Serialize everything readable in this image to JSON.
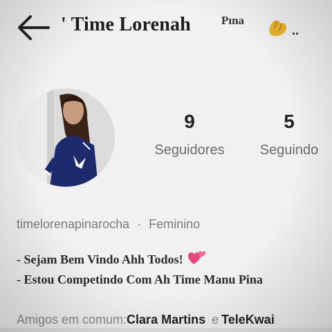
{
  "header": {
    "title": "' Time Lorenah",
    "title_suffix": "Pına",
    "trailing": ".."
  },
  "profile": {
    "followers_count": "9",
    "followers_label": "Seguidores",
    "following_count": "5",
    "following_label": "Seguindo",
    "username": "timelorenapinarocha",
    "separator": "·",
    "gender": "Feminino",
    "bio_line1": "- Sejam Bem Vindo Ahh Todos!",
    "bio_line2": "- Estou Competindo Com Ah Time Manu Pina"
  },
  "mutual": {
    "label": "Amigos em comum:",
    "friend1": "Clara Martins",
    "conjunction": "e",
    "friend2": "TeleKwai"
  },
  "icons": {
    "back": "arrow-left-icon",
    "emoji": "flexed-bicep-icon",
    "heart": "two-hearts-icon"
  },
  "colors": {
    "background": "#f1f1f1",
    "text": "#1a1a1a",
    "muted": "#7a7a7a",
    "heart": "#e8457f"
  }
}
